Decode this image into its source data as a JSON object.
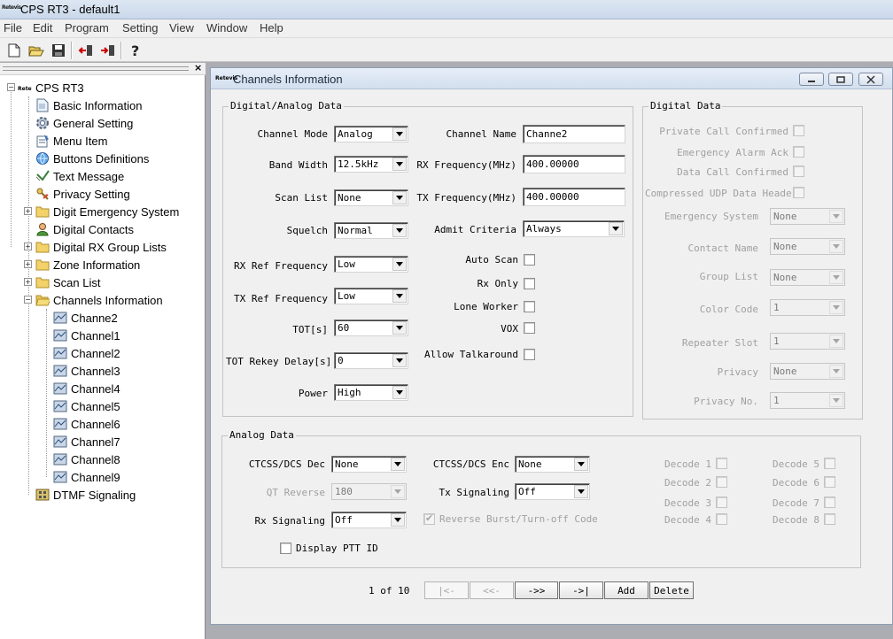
{
  "app": {
    "title": "CPS RT3 - default1",
    "logo": "Retevis"
  },
  "menu": [
    "File",
    "Edit",
    "Program",
    "Setting",
    "View",
    "Window",
    "Help"
  ],
  "toolbar": {
    "buttons": [
      "new-icon",
      "open-icon",
      "save-icon",
      "read-radio-icon",
      "write-radio-icon",
      "help-icon"
    ]
  },
  "tree": {
    "root": "CPS RT3",
    "items": [
      {
        "label": "Basic Information",
        "icon": "document-icon"
      },
      {
        "label": "General Setting",
        "icon": "gear-icon"
      },
      {
        "label": "Menu Item",
        "icon": "menu-icon"
      },
      {
        "label": "Buttons Definitions",
        "icon": "globe-icon"
      },
      {
        "label": "Text Message",
        "icon": "message-icon"
      },
      {
        "label": "Privacy Setting",
        "icon": "key-icon"
      },
      {
        "label": "Digit Emergency System",
        "icon": "folder-icon"
      },
      {
        "label": "Digital Contacts",
        "icon": "contact-icon"
      },
      {
        "label": "Digital RX Group Lists",
        "icon": "folder-icon"
      },
      {
        "label": "Zone Information",
        "icon": "folder-icon"
      },
      {
        "label": "Scan List",
        "icon": "folder-icon"
      },
      {
        "label": "Channels Information",
        "icon": "folder-open-icon"
      },
      {
        "label": "Channe2",
        "icon": "channel-icon"
      },
      {
        "label": "Channel1",
        "icon": "channel-icon"
      },
      {
        "label": "Channel2",
        "icon": "channel-icon"
      },
      {
        "label": "Channel3",
        "icon": "channel-icon"
      },
      {
        "label": "Channel4",
        "icon": "channel-icon"
      },
      {
        "label": "Channel5",
        "icon": "channel-icon"
      },
      {
        "label": "Channel6",
        "icon": "channel-icon"
      },
      {
        "label": "Channel7",
        "icon": "channel-icon"
      },
      {
        "label": "Channel8",
        "icon": "channel-icon"
      },
      {
        "label": "Channel9",
        "icon": "channel-icon"
      },
      {
        "label": "DTMF Signaling",
        "icon": "dtmf-icon"
      }
    ]
  },
  "window": {
    "title": "Channels Information",
    "logo": "Retevis"
  },
  "digital_analog": {
    "legend": "Digital/Analog Data",
    "left_fields": [
      {
        "label": "Channel Mode",
        "value": "Analog"
      },
      {
        "label": "Band Width",
        "value": "12.5kHz"
      },
      {
        "label": "Scan List",
        "value": "None"
      },
      {
        "label": "Squelch",
        "value": "Normal"
      },
      {
        "label": "RX Ref Frequency",
        "value": "Low"
      },
      {
        "label": "TX Ref Frequency",
        "value": "Low"
      },
      {
        "label": "TOT[s]",
        "value": "60"
      },
      {
        "label": "TOT Rekey Delay[s]",
        "value": "0"
      },
      {
        "label": "Power",
        "value": "High"
      }
    ],
    "channel_name": {
      "label": "Channel Name",
      "value": "Channe2"
    },
    "rx_frequency": {
      "label": "RX Frequency(MHz)",
      "value": "400.00000"
    },
    "tx_frequency": {
      "label": "TX Frequency(MHz)",
      "value": "400.00000"
    },
    "admit_criteria": {
      "label": "Admit Criteria",
      "value": "Always"
    },
    "checkboxes": [
      "Auto Scan",
      "Rx Only",
      "Lone Worker",
      "VOX",
      "Allow Talkaround"
    ]
  },
  "digital": {
    "legend": "Digital Data",
    "checkboxes": [
      "Private Call Confirmed",
      "Emergency Alarm Ack",
      "Data Call Confirmed",
      "Compressed UDP Data Header"
    ],
    "fields": [
      {
        "label": "Emergency System",
        "value": "None"
      },
      {
        "label": "Contact Name",
        "value": "None"
      },
      {
        "label": "Group List",
        "value": "None"
      },
      {
        "label": "Color Code",
        "value": "1"
      },
      {
        "label": "Repeater Slot",
        "value": "1"
      },
      {
        "label": "Privacy",
        "value": "None"
      },
      {
        "label": "Privacy No.",
        "value": "1"
      }
    ]
  },
  "analog": {
    "legend": "Analog Data",
    "ctcss_dec": {
      "label": "CTCSS/DCS Dec",
      "value": "None"
    },
    "qt_reverse": {
      "label": "QT Reverse",
      "value": "180"
    },
    "rx_signaling": {
      "label": "Rx Signaling",
      "value": "Off"
    },
    "ctcss_enc": {
      "label": "CTCSS/DCS Enc",
      "value": "None"
    },
    "tx_signaling": {
      "label": "Tx Signaling",
      "value": "Off"
    },
    "reverse_burst": "Reverse Burst/Turn-off Code",
    "display_ptt": "Display PTT ID",
    "decodes": [
      "Decode 1",
      "Decode 2",
      "Decode 3",
      "Decode 4",
      "Decode 5",
      "Decode 6",
      "Decode 7",
      "Decode 8"
    ]
  },
  "nav": {
    "page": "1 of 10",
    "first": "|<-",
    "prev": "<<-",
    "next": "->>",
    "last": "->|",
    "add": "Add",
    "delete": "Delete"
  }
}
